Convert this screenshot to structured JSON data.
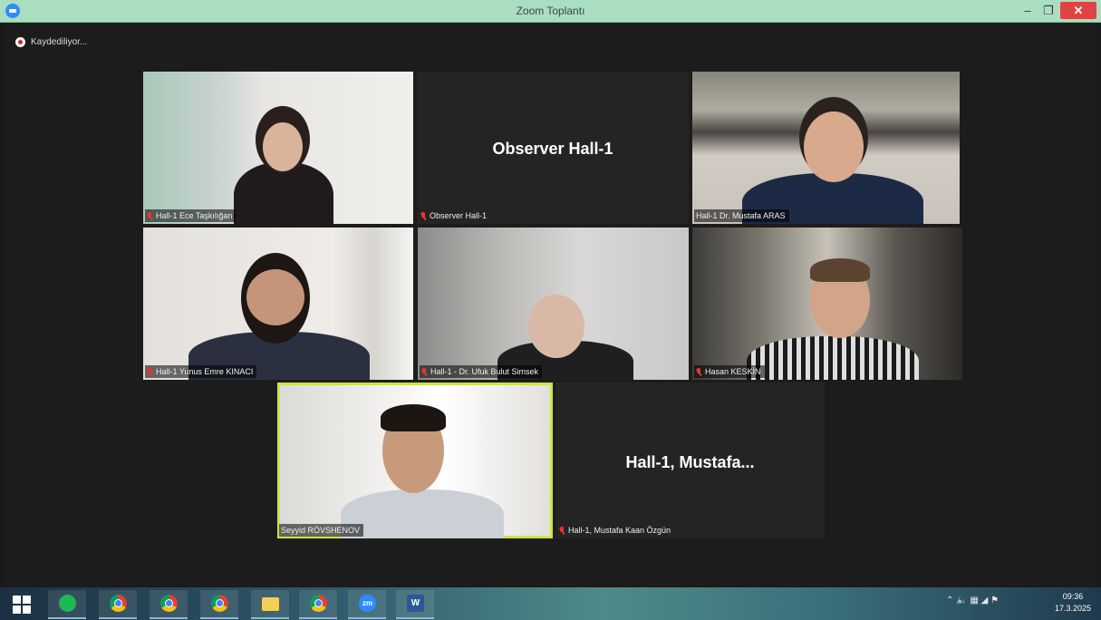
{
  "window": {
    "title": "Zoom Toplantı",
    "minimize_glyph": "–",
    "maximize_glyph": "❐",
    "close_glyph": "✕"
  },
  "recording": {
    "label": "Kaydediliyor..."
  },
  "participants": [
    {
      "name": "Hall-1 Ece Taşkılığan",
      "muted": true,
      "video": true
    },
    {
      "name": "Observer Hall-1",
      "big_label": "Observer Hall-1",
      "muted": true,
      "video": false
    },
    {
      "name": "Hall-1 Dr. Mustafa ARAS",
      "muted": false,
      "video": true
    },
    {
      "name": "Hall-1 Yunus Emre KINACI",
      "muted": true,
      "video": true
    },
    {
      "name": "Hall-1 - Dr. Ufuk Bulut Simsek",
      "muted": true,
      "video": true
    },
    {
      "name": "Hasan KESKİN",
      "muted": true,
      "video": true
    },
    {
      "name": "Seyyid RÖVSHENOV",
      "muted": false,
      "video": true,
      "active_speaker": true
    },
    {
      "name": "Hall-1, Mustafa Kaan Özgün",
      "big_label": "Hall-1,  Mustafa...",
      "muted": true,
      "video": false
    }
  ],
  "taskbar": {
    "zoom_icon_text": "zm",
    "word_icon_text": "W",
    "tray_glyphs": "⌃  🔈  ▦  ◢  ⚑",
    "time": "09:36",
    "date": "17.3.2025"
  },
  "colors": {
    "titlebar": "#a9dfc0",
    "active_speaker_border": "#cfe34a",
    "muted_mic": "#e33333",
    "close_button": "#e04343"
  }
}
